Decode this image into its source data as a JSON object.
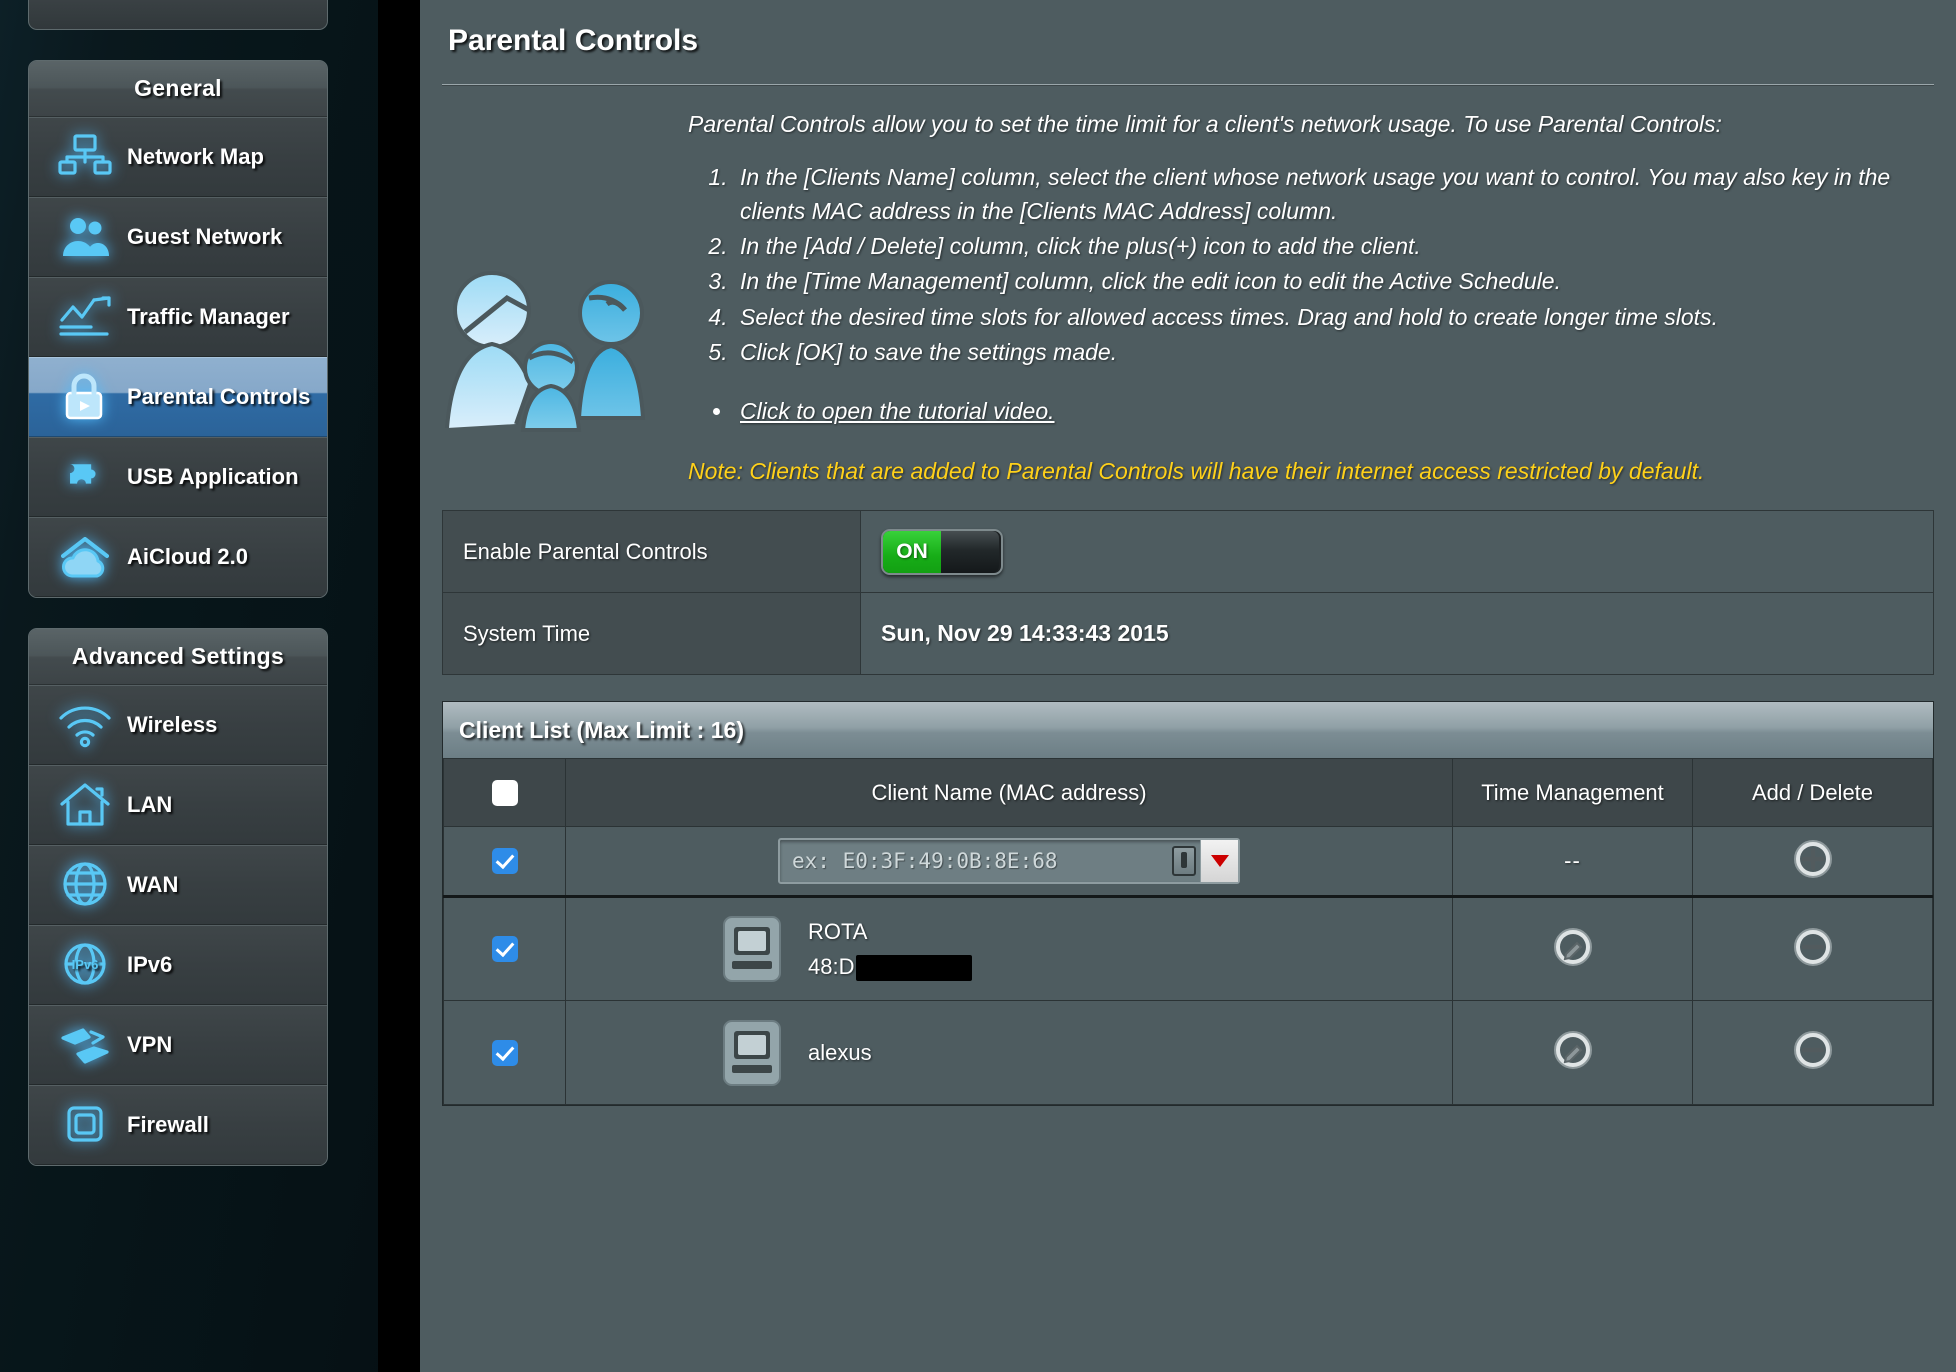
{
  "sidebar": {
    "groups": [
      {
        "title": "General",
        "items": [
          {
            "label": "Network Map",
            "icon": "network-map-icon",
            "active": false
          },
          {
            "label": "Guest Network",
            "icon": "guest-network-icon",
            "active": false
          },
          {
            "label": "Traffic Manager",
            "icon": "traffic-manager-icon",
            "active": false
          },
          {
            "label": "Parental Controls",
            "icon": "parental-controls-lock-icon",
            "active": true
          },
          {
            "label": "USB Application",
            "icon": "usb-application-puzzle-icon",
            "active": false
          },
          {
            "label": "AiCloud 2.0",
            "icon": "aicloud-house-cloud-icon",
            "active": false
          }
        ]
      },
      {
        "title": "Advanced Settings",
        "items": [
          {
            "label": "Wireless",
            "icon": "wireless-wifi-icon",
            "active": false
          },
          {
            "label": "LAN",
            "icon": "lan-house-icon",
            "active": false
          },
          {
            "label": "WAN",
            "icon": "wan-globe-icon",
            "active": false
          },
          {
            "label": "IPv6",
            "icon": "ipv6-globe-icon",
            "active": false
          },
          {
            "label": "VPN",
            "icon": "vpn-arrows-icon",
            "active": false
          },
          {
            "label": "Firewall",
            "icon": "firewall-shield-icon",
            "active": false
          }
        ]
      }
    ]
  },
  "page": {
    "title": "Parental Controls",
    "illustration_icon": "family-parental-controls-illustration",
    "lead": "Parental Controls allow you to set the time limit for a client's network usage. To use Parental Controls:",
    "steps": [
      "In the [Clients Name] column, select the client whose network usage you want to control. You may also key in the clients MAC address in the [Clients MAC Address] column.",
      "In the [Add / Delete] column, click the plus(+) icon to add the client.",
      "In the [Time Management] column, click the edit icon to edit the Active Schedule.",
      "Select the desired time slots for allowed access times. Drag and hold to create longer time slots.",
      "Click [OK] to save the settings made."
    ],
    "tutorial_link": "Click to open the tutorial video.",
    "note": "Note: Clients that are added to Parental Controls will have their internet access restricted by default.",
    "note_color": "#ffd11a"
  },
  "settings": {
    "enable_label": "Enable Parental Controls",
    "enable_state": "ON",
    "enable_on_color": "#17ad17",
    "system_time_label": "System Time",
    "system_time_value": "Sun, Nov 29 14:33:43 2015"
  },
  "client_list": {
    "panel_title": "Client List (Max Limit : 16)",
    "columns": {
      "select": "",
      "name": "Client Name (MAC address)",
      "time": "Time Management",
      "add": "Add / Delete"
    },
    "header_checkbox_checked": false,
    "input_row": {
      "checked": true,
      "placeholder": "ex: E0:3F:49:0B:8E:68",
      "value": "",
      "time_management": "--",
      "action_icon": "plus-circle-icon"
    },
    "rows": [
      {
        "checked": true,
        "device_icon": "desktop-computer-icon",
        "name": "ROTA",
        "mac_prefix": "48:D",
        "mac_redacted": true,
        "time_icon": "edit-pencil-circle-icon",
        "action_icon": "minus-circle-icon"
      },
      {
        "checked": true,
        "device_icon": "desktop-computer-icon",
        "name": "alexus",
        "mac_prefix": "",
        "mac_redacted": false,
        "time_icon": "edit-pencil-circle-icon",
        "action_icon": "minus-circle-icon"
      }
    ]
  }
}
